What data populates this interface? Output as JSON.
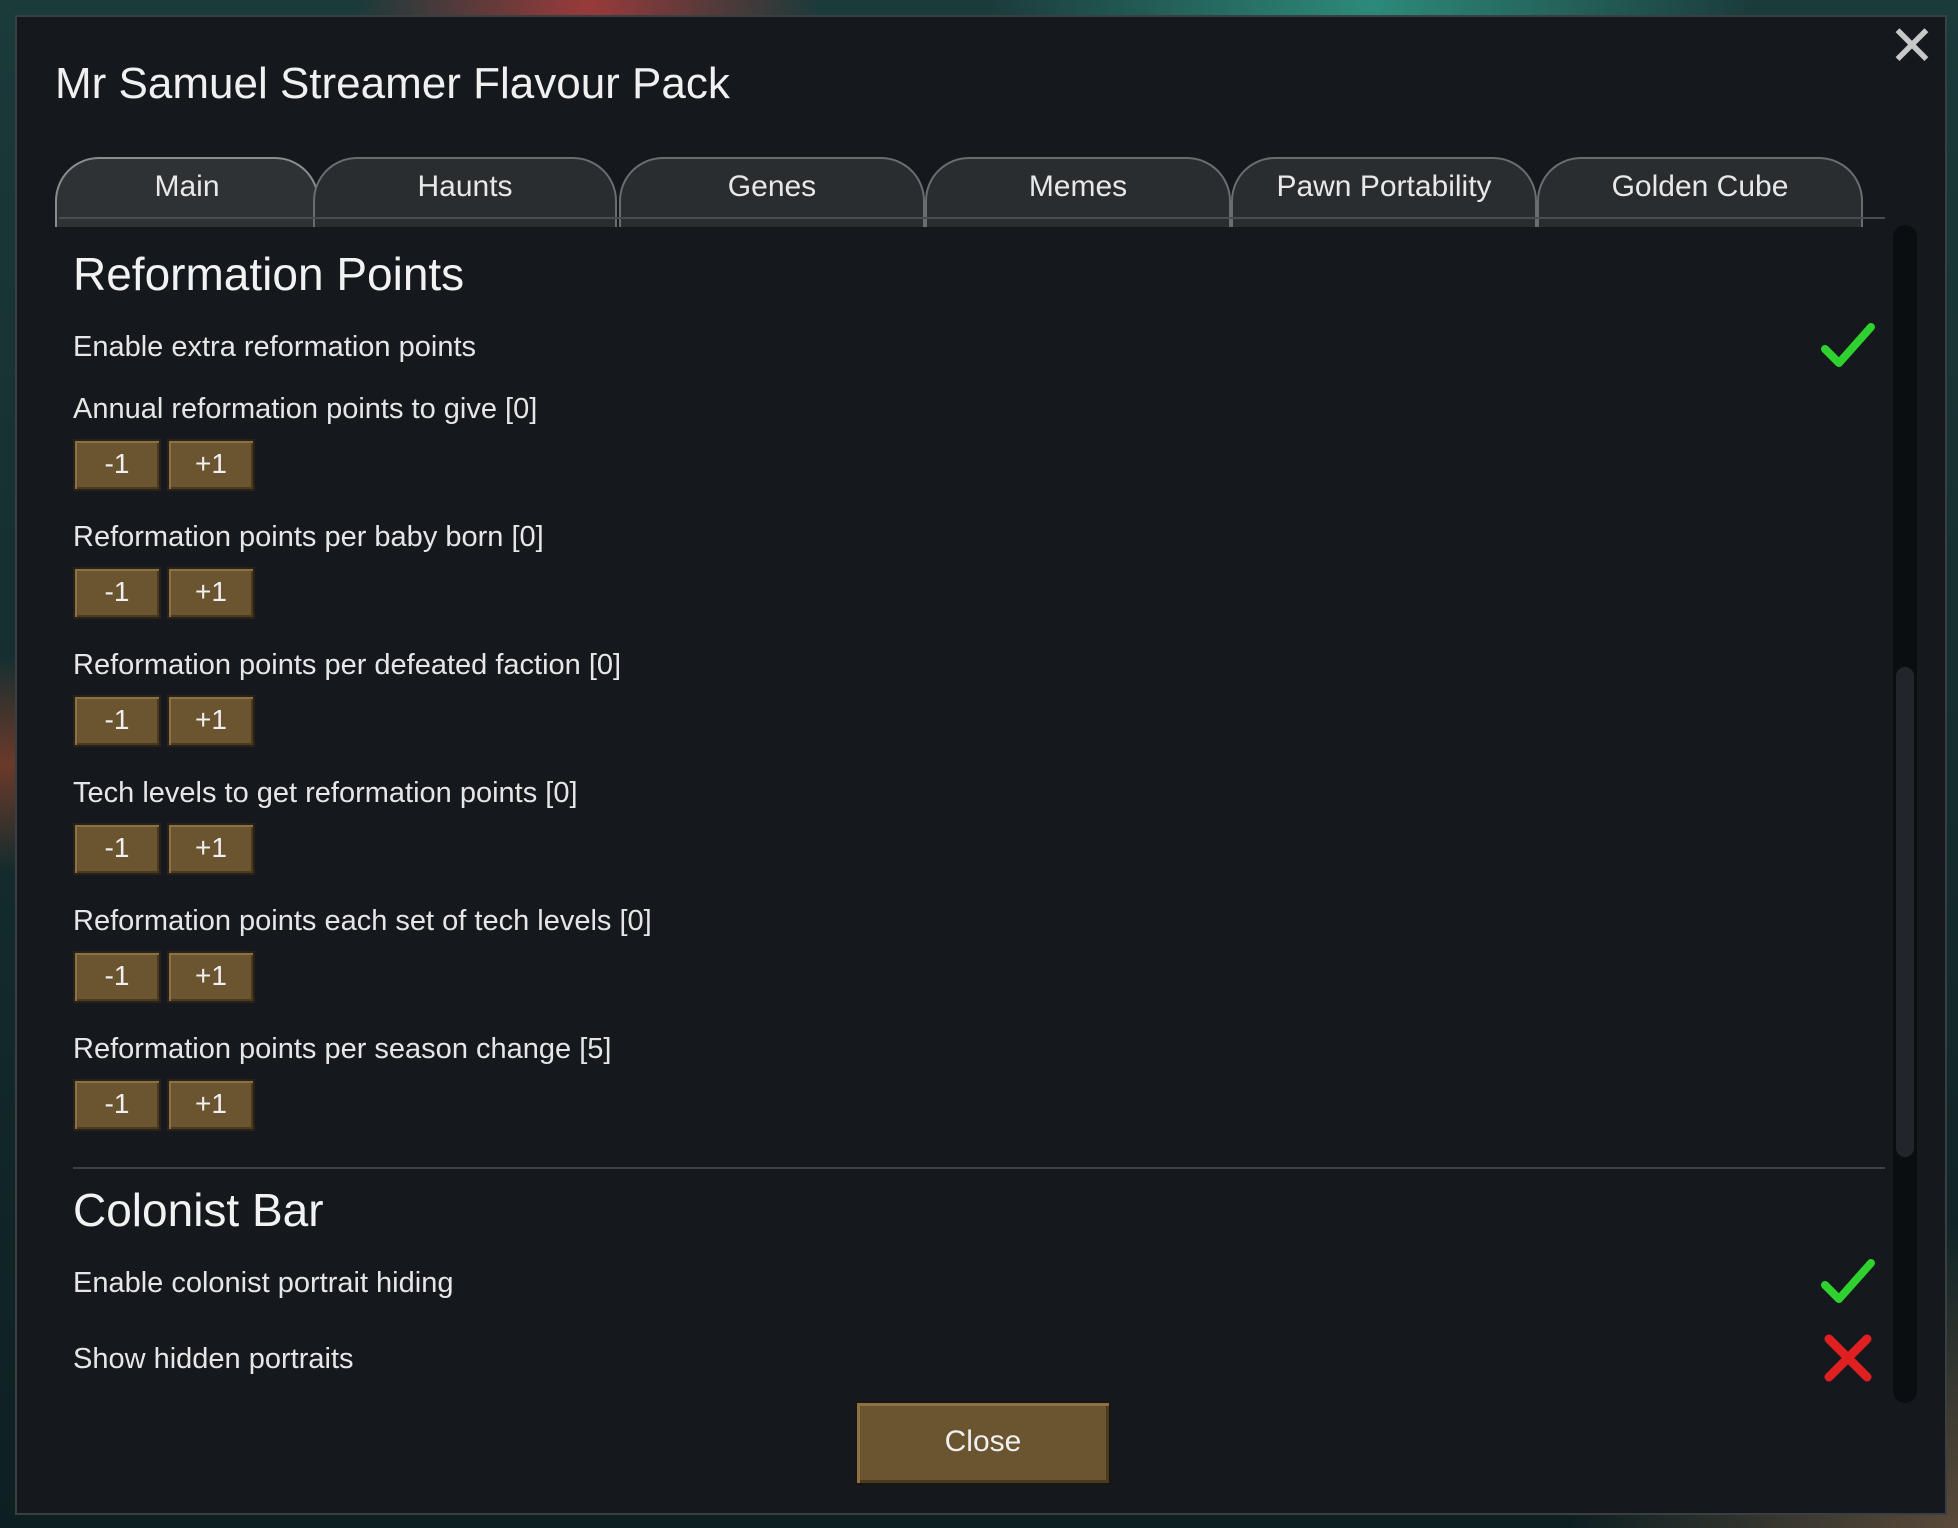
{
  "dialog": {
    "title": "Mr Samuel Streamer Flavour Pack",
    "close_label": "Close"
  },
  "tabs": [
    {
      "label": "Main",
      "active": true
    },
    {
      "label": "Haunts",
      "active": false
    },
    {
      "label": "Genes",
      "active": false
    },
    {
      "label": "Memes",
      "active": false
    },
    {
      "label": "Pawn Portability",
      "active": false
    },
    {
      "label": "Golden Cube",
      "active": false
    }
  ],
  "reformation": {
    "title": "Reformation Points",
    "enable_label": "Enable extra reformation points",
    "enable_value": true,
    "settings": [
      {
        "label": "Annual reformation points to give [0]",
        "dec": "-1",
        "inc": "+1"
      },
      {
        "label": "Reformation points per baby born [0]",
        "dec": "-1",
        "inc": "+1"
      },
      {
        "label": "Reformation points per defeated faction [0]",
        "dec": "-1",
        "inc": "+1"
      },
      {
        "label": "Tech levels to get reformation points [0]",
        "dec": "-1",
        "inc": "+1"
      },
      {
        "label": "Reformation points each set of tech levels [0]",
        "dec": "-1",
        "inc": "+1"
      },
      {
        "label": "Reformation points per season change [5]",
        "dec": "-1",
        "inc": "+1"
      }
    ]
  },
  "colonist_bar": {
    "title": "Colonist Bar",
    "items": [
      {
        "label": "Enable colonist portrait hiding",
        "value": true,
        "icon": "checkmark-icon"
      },
      {
        "label": "Show hidden portraits",
        "value": false,
        "icon": "cross-icon"
      }
    ]
  },
  "colors": {
    "check_green": "#2fd12f",
    "cross_red": "#e02020",
    "button_brown": "#6b5530",
    "panel_bg": "#15191d"
  }
}
